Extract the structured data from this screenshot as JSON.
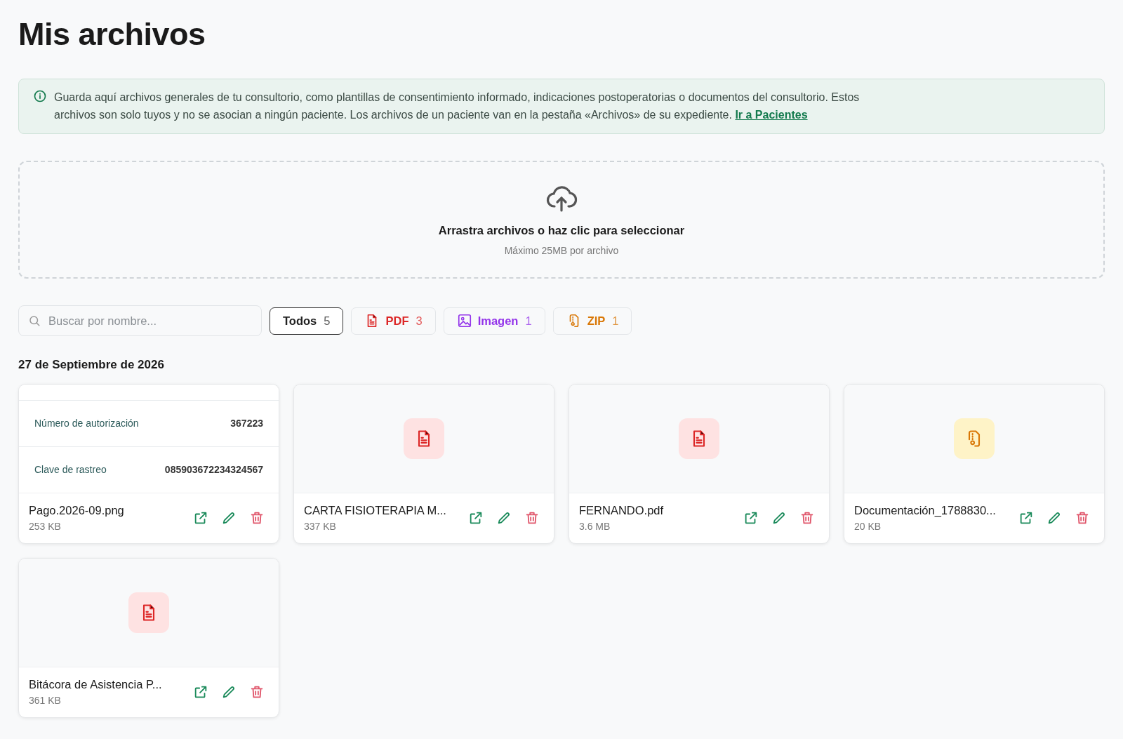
{
  "title": "Mis archivos",
  "info": {
    "text": "Guarda aquí archivos generales de tu consultorio, como plantillas de consentimiento informado, indicaciones postoperatorias o documentos del consultorio. Estos archivos son solo tuyos y no se asocian a ningún paciente. Los archivos de un paciente van en la pestaña «Archivos» de su expediente.",
    "link": "Ir a Pacientes"
  },
  "dropzone": {
    "title": "Arrastra archivos o haz clic para seleccionar",
    "subtitle": "Máximo 25MB por archivo"
  },
  "search": {
    "placeholder": "Buscar por nombre..."
  },
  "filters": [
    {
      "kind": "all",
      "label": "Todos",
      "count": "5",
      "selected": true
    },
    {
      "kind": "pdf",
      "label": "PDF",
      "count": "3",
      "selected": false
    },
    {
      "kind": "image",
      "label": "Imagen",
      "count": "1",
      "selected": false
    },
    {
      "kind": "zip",
      "label": "ZIP",
      "count": "1",
      "selected": false
    }
  ],
  "groups": [
    {
      "date": "27 de Septiembre de 2026",
      "files": [
        {
          "name": "Pago.2026-09.png",
          "size": "253 KB",
          "preview_rows": [
            {
              "label": "Número de autorización",
              "value": "367223"
            },
            {
              "label": "Clave de rastreo",
              "value": "085903672234324567"
            }
          ]
        },
        {
          "kind": "pdf",
          "name": "CARTA FISIOTERAPIA M...",
          "size": "337 KB"
        },
        {
          "kind": "pdf",
          "name": "FERNANDO.pdf",
          "size": "3.6 MB"
        },
        {
          "kind": "zip",
          "name": "Documentación_1788830...",
          "size": "20 KB"
        },
        {
          "kind": "pdf",
          "name": "Bitácora de Asistencia P...",
          "size": "361 KB"
        }
      ]
    }
  ]
}
